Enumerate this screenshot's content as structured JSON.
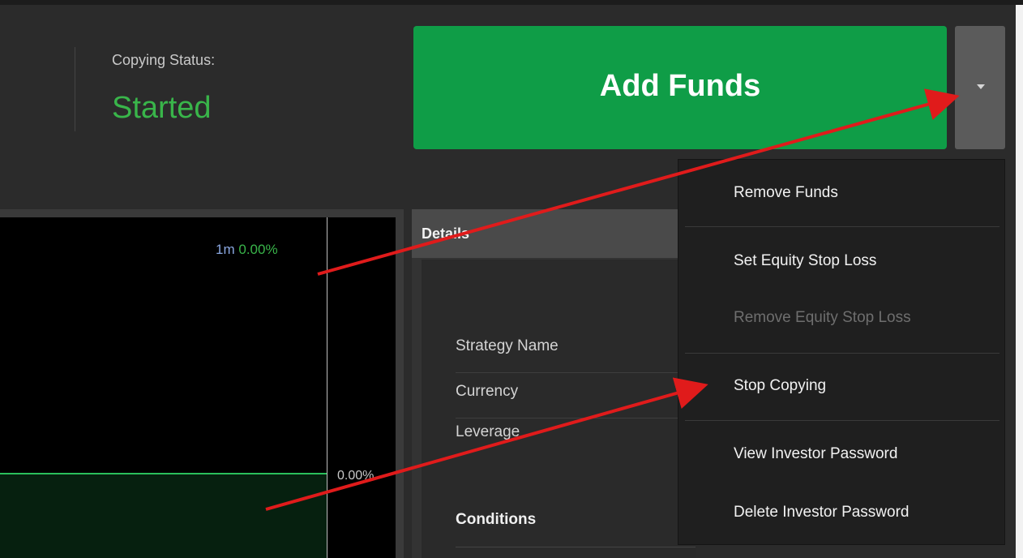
{
  "status": {
    "label": "Copying Status:",
    "value": "Started"
  },
  "actions": {
    "primary_label": "Add Funds",
    "toggle_icon": "caret-down-icon"
  },
  "chart": {
    "period_label": "1m",
    "period_value": "0.00%",
    "axis_value": "0.00%"
  },
  "details": {
    "header": "Details",
    "rows": [
      "Strategy Name",
      "Currency",
      "Leverage"
    ],
    "conditions_label": "Conditions"
  },
  "menu": {
    "items": [
      "Remove Funds",
      "Set Equity Stop Loss",
      "Remove Equity Stop Loss",
      "Stop Copying",
      "View Investor Password",
      "Delete Investor Password"
    ]
  },
  "colors": {
    "accent_green": "#0f9d47",
    "status_green": "#39b54a",
    "annotation_red": "#e01b1b"
  }
}
